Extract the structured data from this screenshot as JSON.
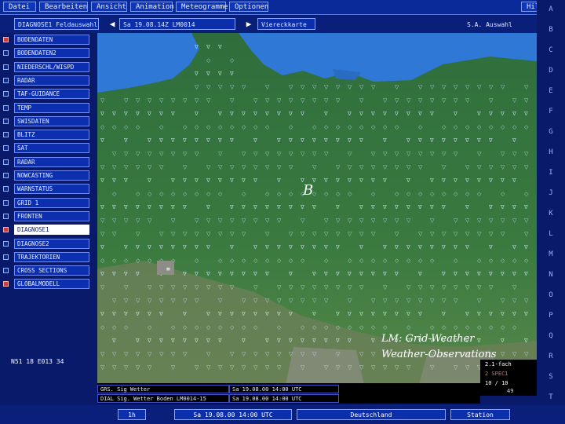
{
  "menubar": {
    "items": [
      "Datei",
      "Bearbeiten",
      "Ansicht",
      "Animation",
      "Meteogramme",
      "Optionen"
    ],
    "help": "Hilfe"
  },
  "toolbar": {
    "product": "DIAGNOSE1 Feldauswahl",
    "datetime": "Sa 19.08.14Z LM0014",
    "view": "Viereckkarte",
    "right_field": "S.A. Auswahl"
  },
  "layers": [
    {
      "label": "BODENDATEN",
      "checked": true,
      "selected": false
    },
    {
      "label": "BODENDATEN2",
      "checked": false,
      "selected": false
    },
    {
      "label": "NIEDERSCHL/WISPD",
      "checked": false,
      "selected": false
    },
    {
      "label": "RADAR",
      "checked": false,
      "selected": false
    },
    {
      "label": "TAF-GUIDANCE",
      "checked": false,
      "selected": false
    },
    {
      "label": "TEMP",
      "checked": false,
      "selected": false
    },
    {
      "label": "SWISDATEN",
      "checked": false,
      "selected": false
    },
    {
      "label": "BLITZ",
      "checked": false,
      "selected": false
    },
    {
      "label": "SAT",
      "checked": false,
      "selected": false
    },
    {
      "label": "RADAR",
      "checked": false,
      "selected": false
    },
    {
      "label": "NOWCASTING",
      "checked": false,
      "selected": false
    },
    {
      "label": "WARNSTATUS",
      "checked": false,
      "selected": false
    },
    {
      "label": "GRID 1",
      "checked": false,
      "selected": false
    },
    {
      "label": "FRONTEN",
      "checked": false,
      "selected": false
    },
    {
      "label": "DIAGNOSE1",
      "checked": true,
      "selected": true
    },
    {
      "label": "DIAGNOSE2",
      "checked": false,
      "selected": false
    },
    {
      "label": "TRAJEKTORIEN",
      "checked": false,
      "selected": false
    },
    {
      "label": "CROSS SECTIONS",
      "checked": false,
      "selected": false
    },
    {
      "label": "GLOBALMODELL",
      "checked": true,
      "selected": false
    }
  ],
  "coordinates": "N51 18 E013 34",
  "map": {
    "pressure_label": "B",
    "annotation_line1": "LM: Grid-Weather",
    "annotation_line2": "Weather-Observations",
    "colors": {
      "land": "#2f6e3c",
      "sea": "#2f78d6",
      "mountain": "#6b7f57",
      "symbol": "#d8ecff"
    }
  },
  "status": {
    "row1_left": "GRS. Sig Wetter",
    "row1_right": "Sa 19.08.00 14:00 UTC",
    "row2_left": "DIAL Sig. Wetter Boden LM0014-15",
    "row2_right": "Sa 19.08.00 14:00 UTC"
  },
  "legend": {
    "line1": "2.1-fach",
    "line2": "2 SPEC1",
    "line3": "10 / 10",
    "line4": "49"
  },
  "bottombar": {
    "step": "1h",
    "datetime": "Sa 19.08.00 14:00 UTC",
    "region": "Deutschland",
    "mode": "Station"
  },
  "rightbar": {
    "buttons": [
      "A",
      "B",
      "C",
      "D",
      "E",
      "F",
      "G",
      "H",
      "I",
      "J",
      "K",
      "L",
      "M",
      "N",
      "O",
      "P",
      "Q",
      "R",
      "S",
      "T"
    ]
  }
}
